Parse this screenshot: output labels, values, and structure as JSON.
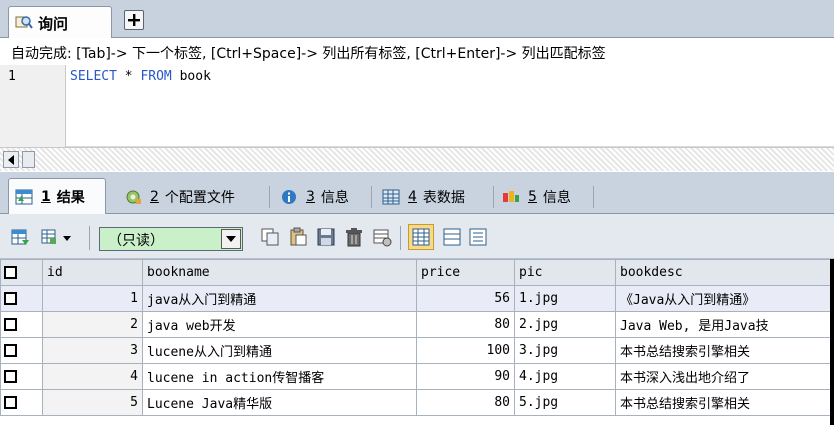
{
  "query_tab": {
    "label": "询问",
    "icon": "query-icon"
  },
  "add_tab": {
    "icon": "plus-icon"
  },
  "editor": {
    "hint": "自动完成: [Tab]-> 下一个标签, [Ctrl+Space]-> 列出所有标签, [Ctrl+Enter]-> 列出匹配标签",
    "line_number": "1",
    "sql": {
      "kw1": "SELECT",
      "star": "*",
      "kw2": "FROM",
      "table": "book"
    }
  },
  "result_tabs": [
    {
      "num": "1",
      "label": "结果",
      "icon": "grid-result-icon",
      "active": true
    },
    {
      "num": "2",
      "label": "个配置文件",
      "icon": "profile-icon",
      "active": false
    },
    {
      "num": "3",
      "label": "信息",
      "icon": "info-icon",
      "active": false
    },
    {
      "num": "4",
      "label": "表数据",
      "icon": "table-data-icon",
      "active": false
    },
    {
      "num": "5",
      "label": "信息",
      "icon": "info-history-icon",
      "active": false
    }
  ],
  "toolbar": {
    "mode": "（只读）",
    "icons": [
      "export-icon",
      "copy-icon",
      "paste-icon",
      "save-icon",
      "delete-icon",
      "refresh-icon",
      "grid-view-icon",
      "form-view-icon",
      "text-view-icon"
    ]
  },
  "grid": {
    "columns": [
      "id",
      "bookname",
      "price",
      "pic",
      "bookdesc"
    ],
    "rows": [
      {
        "id": "1",
        "bookname": "java从入门到精通",
        "price": "56",
        "pic": "1.jpg",
        "bookdesc": "《Java从入门到精通》"
      },
      {
        "id": "2",
        "bookname": "java web开发",
        "price": "80",
        "pic": "2.jpg",
        "bookdesc": "Java Web, 是用Java技"
      },
      {
        "id": "3",
        "bookname": "lucene从入门到精通",
        "price": "100",
        "pic": "3.jpg",
        "bookdesc": "本书总结搜索引擎相关"
      },
      {
        "id": "4",
        "bookname": "lucene in action传智播客",
        "price": "90",
        "pic": "4.jpg",
        "bookdesc": "本书深入浅出地介绍了"
      },
      {
        "id": "5",
        "bookname": "Lucene Java精华版",
        "price": "80",
        "pic": "5.jpg",
        "bookdesc": "本书总结搜索引擎相关"
      }
    ]
  }
}
